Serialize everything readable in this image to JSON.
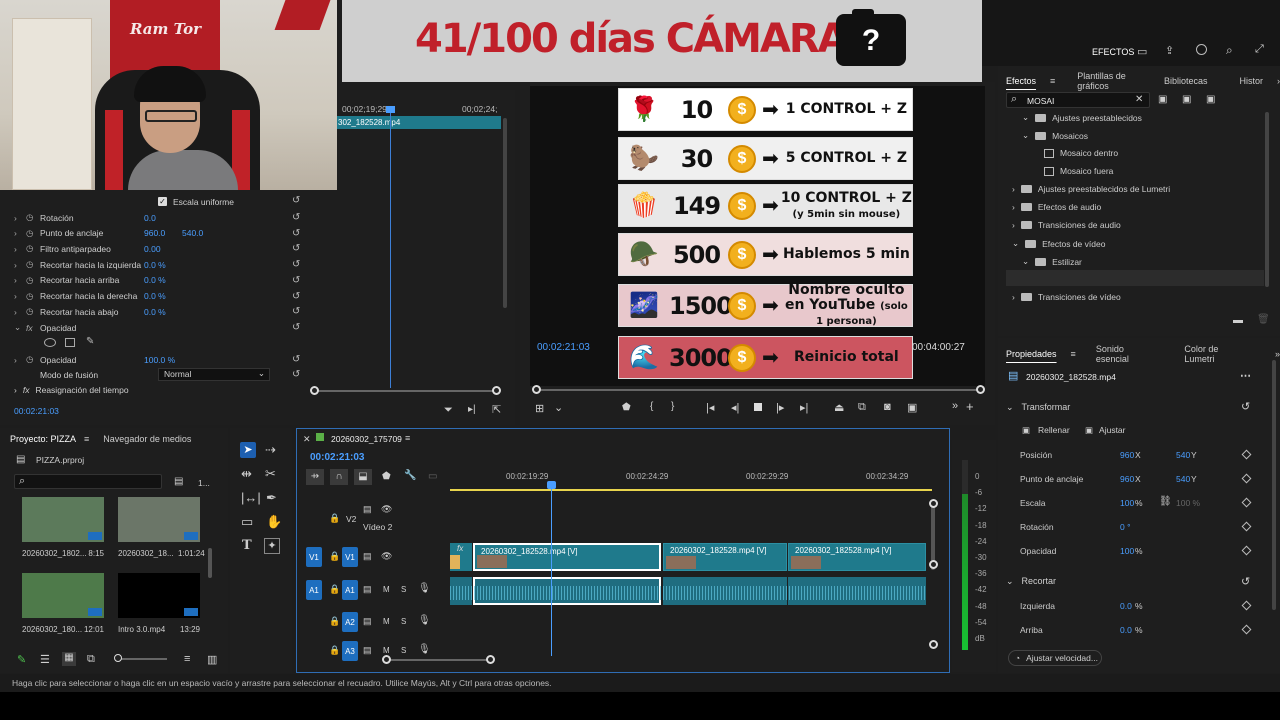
{
  "banner": {
    "title": "41/100 días CÁMARA"
  },
  "stickers": [
    {
      "emoji": "🌹",
      "num": "10",
      "text": "1 CONTROL + Z",
      "sub": ""
    },
    {
      "emoji": "🦫",
      "num": "30",
      "text": "5 CONTROL + Z",
      "sub": ""
    },
    {
      "emoji": "🍿",
      "num": "149",
      "text": "10 CONTROL + Z",
      "sub": "(y 5min sin mouse)"
    },
    {
      "emoji": "🪖",
      "num": "500",
      "text": "Hablemos 5 min",
      "sub": ""
    },
    {
      "emoji": "🌌",
      "num": "1500",
      "text": "Nombre oculto en YouTube",
      "sub": "(solo 1 persona)"
    },
    {
      "emoji": "🌊",
      "num": "3000",
      "text": "Reinicio total",
      "sub": ""
    }
  ],
  "webcam": {
    "sign": "Ram Tor"
  },
  "effect_controls": {
    "ruler_start": "00;02;19;29",
    "ruler_end": "00;02;24;",
    "clip_name": "302_182528.mp4",
    "uniform_scale": "Escala uniforme",
    "rows": [
      {
        "label": "Rotación",
        "v1": "0.0",
        "v2": ""
      },
      {
        "label": "Punto de anclaje",
        "v1": "960.0",
        "v2": "540.0"
      },
      {
        "label": "Filtro antiparpadeo",
        "v1": "0.00",
        "v2": ""
      },
      {
        "label": "Recortar hacia la izquierda",
        "v1": "0.0 %",
        "v2": ""
      },
      {
        "label": "Recortar hacia arriba",
        "v1": "0.0 %",
        "v2": ""
      },
      {
        "label": "Recortar hacia la derecha",
        "v1": "0.0 %",
        "v2": ""
      },
      {
        "label": "Recortar hacia abajo",
        "v1": "0.0 %",
        "v2": ""
      }
    ],
    "opacity_section": "Opacidad",
    "opacity_label": "Opacidad",
    "opacity_value": "100.0 %",
    "blend_label": "Modo de fusión",
    "blend_value": "Normal",
    "time_remap": "Reasignación del tiempo",
    "timecode": "00:02:21:03"
  },
  "program": {
    "timecode_left": "00:02:21:03",
    "timecode_right": "00:04:00:27"
  },
  "effects_panel": {
    "header": "EFECTOS",
    "tabs": [
      "Efectos",
      "Plantillas de gráficos",
      "Bibliotecas",
      "Histor"
    ],
    "search": "MOSAI",
    "tree": [
      {
        "label": "Ajustes preestablecidos",
        "indent": 1,
        "type": "folder"
      },
      {
        "label": "Mosaicos",
        "indent": 1,
        "type": "folder"
      },
      {
        "label": "Mosaico dentro",
        "indent": 2,
        "type": "item"
      },
      {
        "label": "Mosaico fuera",
        "indent": 2,
        "type": "item"
      },
      {
        "label": "Ajustes preestablecidos de Lumetri",
        "indent": 0,
        "type": "folder"
      },
      {
        "label": "Efectos de audio",
        "indent": 0,
        "type": "folder"
      },
      {
        "label": "Transiciones de audio",
        "indent": 0,
        "type": "folder"
      },
      {
        "label": "Efectos de vídeo",
        "indent": 0,
        "type": "folder"
      },
      {
        "label": "Estilizar",
        "indent": 1,
        "type": "folder"
      },
      {
        "label": "Mosaico",
        "indent": 2,
        "type": "item"
      },
      {
        "label": "Transiciones de vídeo",
        "indent": 0,
        "type": "folder"
      }
    ]
  },
  "properties": {
    "tabs": [
      "Propiedades",
      "Sonido esencial",
      "Color de Lumetri"
    ],
    "clip": "20260302_182528.mp4",
    "transform": "Transformar",
    "fill": "Rellenar",
    "fit": "Ajustar",
    "position": {
      "label": "Posición",
      "x": "960",
      "y": "540"
    },
    "anchor": {
      "label": "Punto de anclaje",
      "x": "960",
      "y": "540"
    },
    "scale": {
      "label": "Escala",
      "v": "100",
      "v2": "100 %"
    },
    "rotation": {
      "label": "Rotación",
      "v": "0 °"
    },
    "opacity": {
      "label": "Opacidad",
      "v": "100"
    },
    "crop": "Recortar",
    "left": {
      "label": "Izquierda",
      "v": "0.0"
    },
    "top": {
      "label": "Arriba",
      "v": "0.0"
    },
    "speed_btn": "Ajustar velocidad..."
  },
  "project": {
    "tabs": [
      "Proyecto: PIZZA",
      "Navegador de medios"
    ],
    "file": "PIZZA.prproj",
    "count": "1...",
    "items": [
      {
        "name": "20260302_1802...",
        "dur": "8:15"
      },
      {
        "name": "20260302_18...",
        "dur": "1:01:24"
      },
      {
        "name": "20260302_180...",
        "dur": "12:01"
      },
      {
        "name": "Intro 3.0.mp4",
        "dur": "13:29"
      }
    ]
  },
  "timeline": {
    "sequence": "20260302_175709",
    "timecode": "00:02:21:03",
    "ruler": [
      "00:02:19:29",
      "00:02:24:29",
      "00:02:29:29",
      "00:02:34:29"
    ],
    "v2_label": "V2",
    "v2_name": "Vídeo 2",
    "clips": [
      "20260302_182528.mp4 [V]",
      "20260302_182528.mp4 [V]",
      "20260302_182528.mp4 [V]"
    ],
    "tracks": [
      "V1",
      "A1",
      "A2",
      "A3"
    ],
    "meter_ticks": [
      "0",
      "-6",
      "-12",
      "-18",
      "-24",
      "-30",
      "-36",
      "-42",
      "-48",
      "-54",
      "dB"
    ]
  },
  "status": "Haga clic para seleccionar o haga clic en un espacio vacío y arrastre para seleccionar el recuadro. Utilice Mayús, Alt y Ctrl para otras opciones."
}
